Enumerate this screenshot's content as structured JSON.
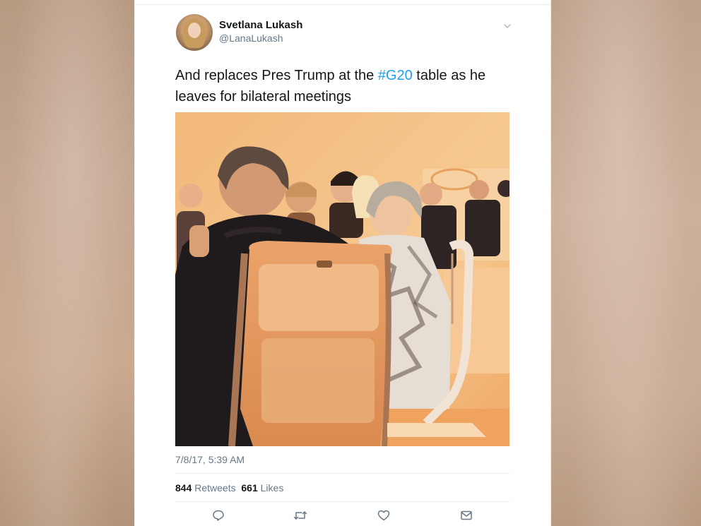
{
  "tweet": {
    "display_name": "Svetlana Lukash",
    "handle": "@LanaLukash",
    "text_before": "And replaces Pres Trump at the ",
    "hashtag": "#G20",
    "text_after": " table as he leaves for bilateral meetings",
    "timestamp": "7/8/17, 5:39 AM",
    "retweets_count": "844",
    "retweets_label": "Retweets",
    "likes_count": "661",
    "likes_label": "Likes"
  },
  "colors": {
    "link": "#1da1f2",
    "text": "#14171a",
    "muted": "#657786"
  },
  "icons": {
    "menu": "chevron-down-icon",
    "reply": "reply-icon",
    "retweet": "retweet-icon",
    "like": "heart-icon",
    "message": "envelope-icon"
  }
}
